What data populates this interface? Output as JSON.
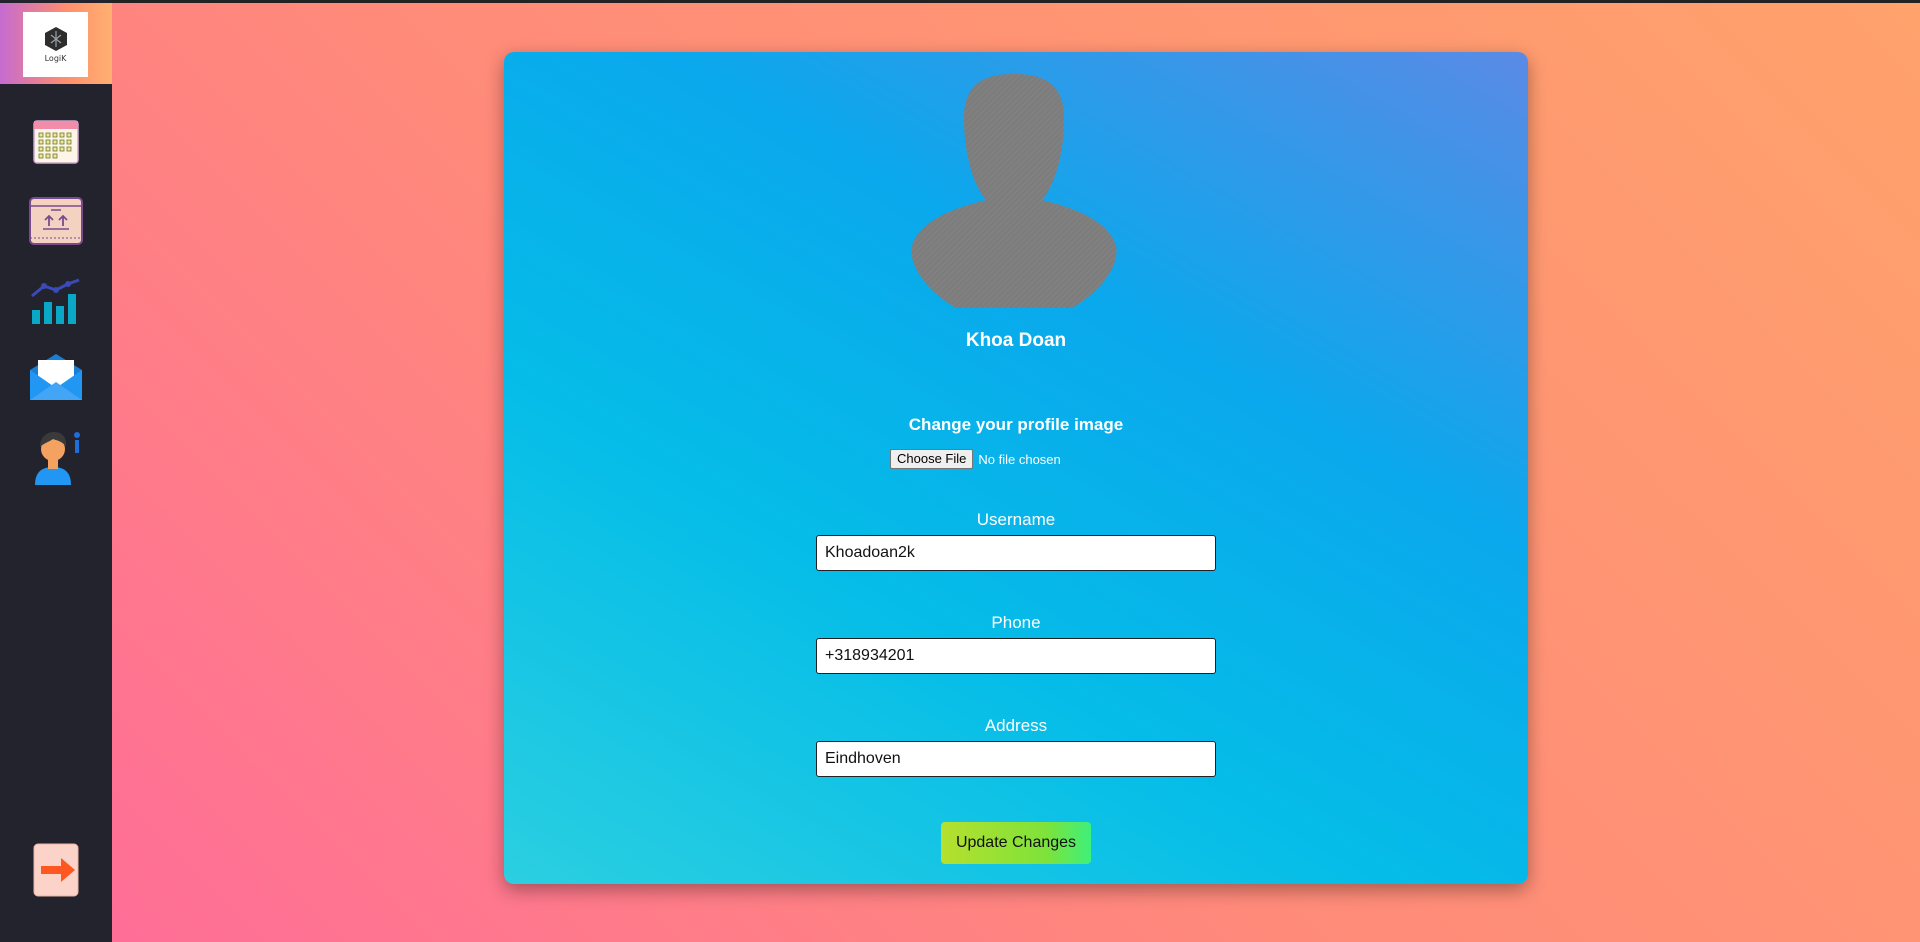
{
  "sidebar": {
    "logo_text": "LogiK",
    "items": [
      {
        "name": "calendar-icon"
      },
      {
        "name": "box-upload-icon"
      },
      {
        "name": "bar-chart-icon"
      },
      {
        "name": "mail-icon"
      },
      {
        "name": "user-info-icon"
      }
    ],
    "logout_icon": "arrow-right-icon"
  },
  "profile": {
    "full_name": "Khoa Doan",
    "change_image_label": "Change your profile image",
    "file_button_label": "Choose File",
    "file_status": "No file chosen",
    "username_label": "Username",
    "username_value": "Khoadoan2k",
    "phone_label": "Phone",
    "phone_value": "+318934201",
    "address_label": "Address",
    "address_value": "Eindhoven",
    "update_button_label": "Update Changes"
  },
  "colors": {
    "sidebar_bg": "#23232e",
    "card_gradient": [
      "#2bcfe0",
      "#05bde8",
      "#0aa8ec",
      "#5a8ae6"
    ],
    "update_button": [
      "#b6e02e",
      "#3ef07a"
    ],
    "logout_arrow": "#ff5722"
  }
}
